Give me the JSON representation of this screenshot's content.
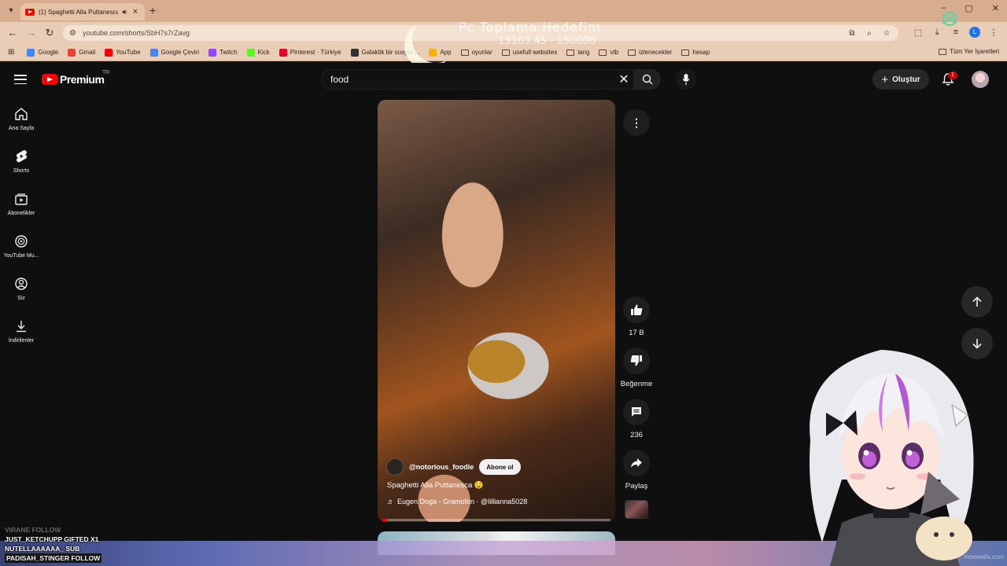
{
  "browser": {
    "tab": {
      "title": "(1) Spaghetti Alla Puttanesca",
      "audio_icon": "speaker-icon"
    },
    "url": "youtube.com/shorts/SbH7s7rZavg",
    "bookmarks": [
      {
        "label": "Google",
        "color": "#4285f4"
      },
      {
        "label": "Gmail",
        "color": "#ea4335"
      },
      {
        "label": "YouTube",
        "color": "#ff0000"
      },
      {
        "label": "Google Çeviri",
        "color": "#4285f4"
      },
      {
        "label": "Twitch",
        "color": "#9146ff"
      },
      {
        "label": "Kick",
        "color": "#53fc18"
      },
      {
        "label": "Pinterest · Türkiye",
        "color": "#e60023"
      },
      {
        "label": "Galaktik bir sosyal ...",
        "color": "#333333"
      },
      {
        "label": "App",
        "color": "#f4b400"
      },
      {
        "label": "oyunlar",
        "folder": true
      },
      {
        "label": "usefull websites",
        "folder": true
      },
      {
        "label": "lang",
        "folder": true
      },
      {
        "label": "vtb",
        "folder": true
      },
      {
        "label": "izlenecekler",
        "folder": true
      },
      {
        "label": "hesap",
        "folder": true
      }
    ],
    "all_bookmarks": "Tüm Yer İşaretleri",
    "profile_initial": "L"
  },
  "overlay": {
    "goal_title": "Pc Toplama Hedefim",
    "goal_progress": "13103.45 · 150000"
  },
  "youtube": {
    "brand": "Premium",
    "country": "TR",
    "search": {
      "query": "food"
    },
    "create_label": "Oluştur",
    "notification_count": "1",
    "sidebar": [
      {
        "label": "Ana Sayfa",
        "icon": "home-icon"
      },
      {
        "label": "Shorts",
        "icon": "shorts-icon"
      },
      {
        "label": "Abonelikler",
        "icon": "subscriptions-icon"
      },
      {
        "label": "YouTube Mu...",
        "icon": "youtube-music-icon"
      },
      {
        "label": "Siz",
        "icon": "you-icon"
      },
      {
        "label": "İndirilenler",
        "icon": "downloads-icon"
      }
    ],
    "short": {
      "channel": "@notorious_foodie",
      "subscribe_label": "Abone ol",
      "title": "Spaghetti Alla Puttanesca 🤤",
      "music": "Eugen Doga - Gramofon · @lillianna5028",
      "progress": 0.02
    },
    "actions": {
      "likes": "17 B",
      "dislike_label": "Beğenme",
      "comments": "236",
      "share_label": "Paylaş"
    }
  },
  "stream_events": [
    {
      "text": "VIRANE  FOLLOW",
      "faded": true
    },
    {
      "text": "JUST_KETCHUPP  GIFTED X1"
    },
    {
      "text": "NUTELLAAAAAA_  SUB"
    },
    {
      "text": "PADISAH_STINGER  FOLLOW",
      "highlight": true
    }
  ],
  "watermark": "moewalls.com"
}
